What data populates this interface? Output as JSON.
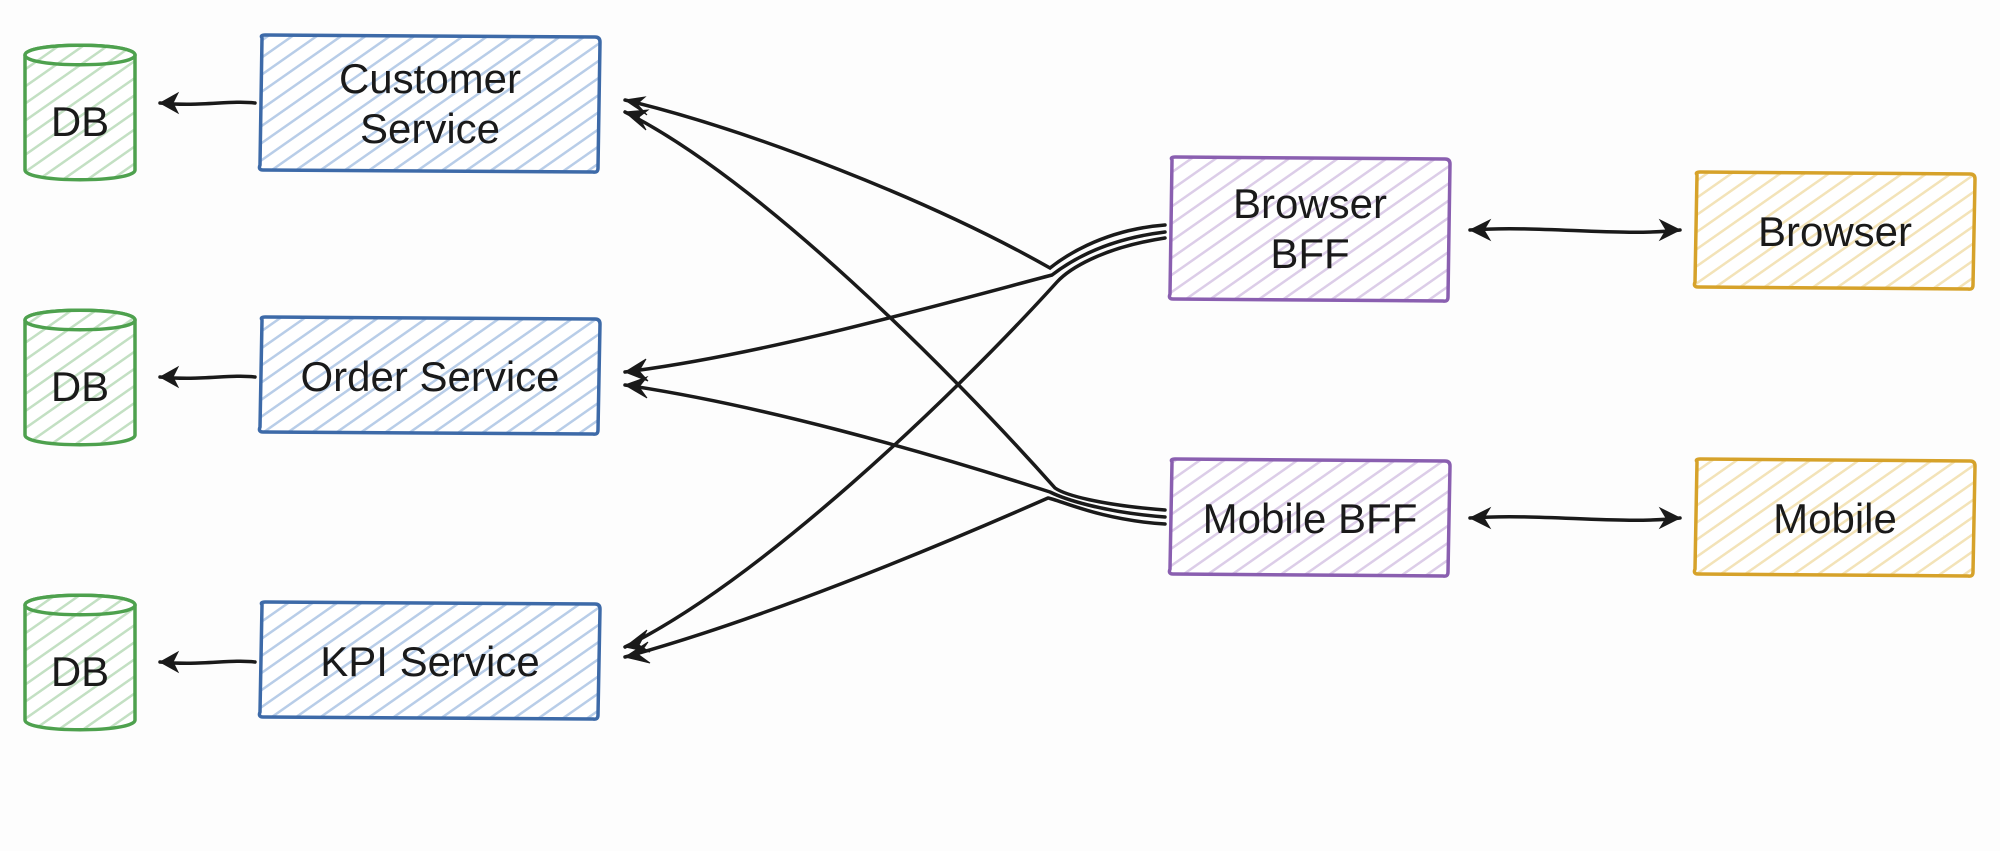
{
  "nodes": {
    "db1": {
      "label": "DB",
      "type": "database"
    },
    "db2": {
      "label": "DB",
      "type": "database"
    },
    "db3": {
      "label": "DB",
      "type": "database"
    },
    "customer_service": {
      "label_line1": "Customer",
      "label_line2": "Service",
      "type": "service"
    },
    "order_service": {
      "label": "Order Service",
      "type": "service"
    },
    "kpi_service": {
      "label": "KPI Service",
      "type": "service"
    },
    "browser_bff": {
      "label_line1": "Browser",
      "label_line2": "BFF",
      "type": "bff"
    },
    "mobile_bff": {
      "label": "Mobile BFF",
      "type": "bff"
    },
    "browser": {
      "label": "Browser",
      "type": "client"
    },
    "mobile": {
      "label": "Mobile",
      "type": "client"
    }
  },
  "edges": [
    {
      "from": "customer_service",
      "to": "db1",
      "direction": "uni"
    },
    {
      "from": "order_service",
      "to": "db2",
      "direction": "uni"
    },
    {
      "from": "kpi_service",
      "to": "db3",
      "direction": "uni"
    },
    {
      "from": "browser_bff",
      "to": "customer_service",
      "direction": "uni"
    },
    {
      "from": "browser_bff",
      "to": "order_service",
      "direction": "uni"
    },
    {
      "from": "browser_bff",
      "to": "kpi_service",
      "direction": "uni"
    },
    {
      "from": "mobile_bff",
      "to": "customer_service",
      "direction": "uni"
    },
    {
      "from": "mobile_bff",
      "to": "order_service",
      "direction": "uni"
    },
    {
      "from": "mobile_bff",
      "to": "kpi_service",
      "direction": "uni"
    },
    {
      "from": "browser_bff",
      "to": "browser",
      "direction": "bi"
    },
    {
      "from": "mobile_bff",
      "to": "mobile",
      "direction": "bi"
    }
  ],
  "colors": {
    "service": "#3d6aa8",
    "database": "#4ea14e",
    "bff": "#8a5fb0",
    "client": "#d6a22a",
    "arrow": "#1a1a1a"
  }
}
